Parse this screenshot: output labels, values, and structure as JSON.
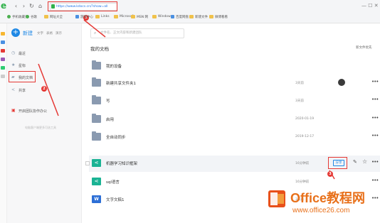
{
  "browser": {
    "url": "https://www.kdocs.cn/?show=all",
    "bookmarks": [
      "手机收藏夹",
      "谷歌",
      "网址大全",
      "游戏中心",
      "Links",
      "Microsoft",
      "MSN 网",
      "Windows",
      "百度网盘",
      "新建文件",
      "微博看看"
    ],
    "controls": "— ☐ ✕"
  },
  "steps": [
    "1",
    "2",
    "3"
  ],
  "sidebar": {
    "new_label": "新建",
    "new_types": [
      "文字",
      "表格",
      "演示"
    ],
    "items": [
      {
        "label": "最近",
        "icon": "clock-icon"
      },
      {
        "label": "星标",
        "icon": "star-icon"
      },
      {
        "label": "我的文档",
        "icon": "folder-icon"
      },
      {
        "label": "共享",
        "icon": "share-icon"
      },
      {
        "label": "开启团队协作办公",
        "icon": "team-icon"
      }
    ],
    "footer": "电脑客户端更多可选工具"
  },
  "main": {
    "search_placeholder": "文件名、正文内容和新建团队",
    "title": "我的文档",
    "sort_label": "新文件优先",
    "share_label": "分享",
    "rows": [
      {
        "name": "我的设备",
        "type": "folder",
        "time": "",
        "avatar": false
      },
      {
        "name": "新建共享文件夹1",
        "type": "shared-folder",
        "time": "3天前",
        "avatar": true
      },
      {
        "name": "写",
        "type": "folder",
        "time": "3天前",
        "avatar": false
      },
      {
        "name": "启用",
        "type": "folder",
        "time": "2020-01-19",
        "avatar": false
      },
      {
        "name": "全自动同步",
        "type": "folder",
        "time": "2019-12-17",
        "avatar": false
      },
      {
        "name": "机器学习知识框架",
        "type": "mindmap",
        "time": "16分钟前",
        "avatar": false,
        "selected": true
      },
      {
        "name": "sql语言",
        "type": "mindmap",
        "time": "16分钟前",
        "avatar": false
      },
      {
        "name": "文字文稿1",
        "type": "word",
        "time": "3天前",
        "avatar": false
      }
    ]
  },
  "watermark": {
    "brand": "Office教程网",
    "url": "www.office26.com"
  },
  "colors": {
    "accent": "#1e88e5",
    "highlight": "#e53935",
    "brand": "#e8701a",
    "folder": "#8a9ab0",
    "mindmap": "#1ab394"
  }
}
